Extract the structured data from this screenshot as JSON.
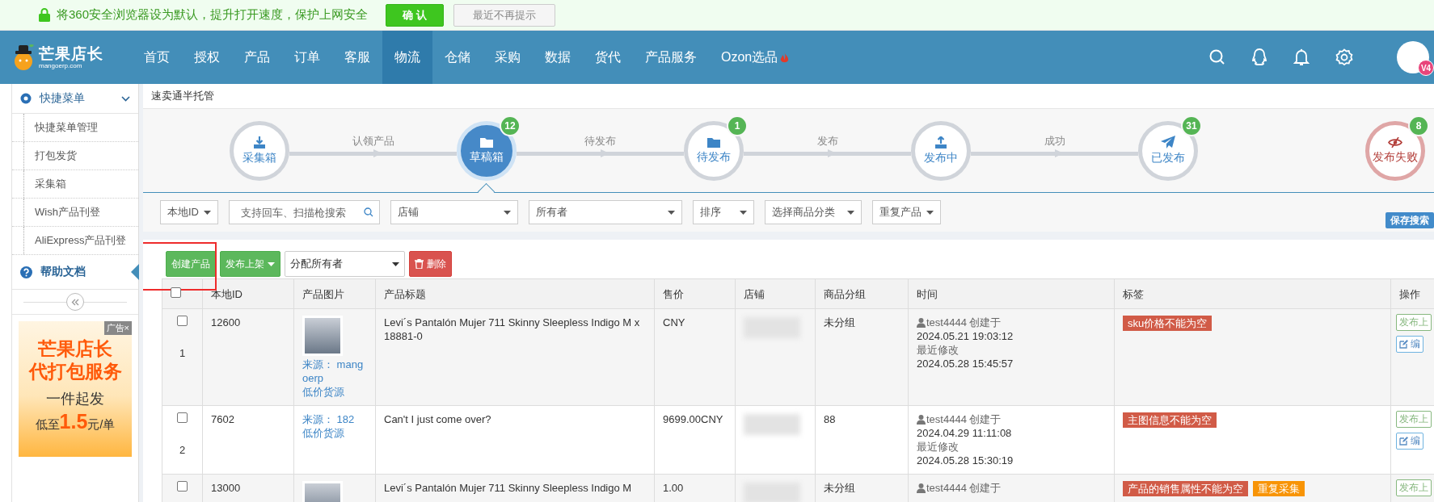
{
  "notice": {
    "text": "将360安全浏览器设为默认，提升打开速度，保护上网安全",
    "confirm": "确 认",
    "dismiss": "最近不再提示"
  },
  "brand": {
    "name": "芒果店长",
    "domain": "mangoerp.com"
  },
  "nav": [
    {
      "label": "首页",
      "selected": false,
      "hot": false
    },
    {
      "label": "授权",
      "selected": false,
      "hot": false
    },
    {
      "label": "产品",
      "selected": false,
      "hot": false
    },
    {
      "label": "订单",
      "selected": false,
      "hot": false
    },
    {
      "label": "客服",
      "selected": false,
      "hot": false
    },
    {
      "label": "物流",
      "selected": true,
      "hot": false
    },
    {
      "label": "仓储",
      "selected": false,
      "hot": false
    },
    {
      "label": "采购",
      "selected": false,
      "hot": false
    },
    {
      "label": "数据",
      "selected": false,
      "hot": false
    },
    {
      "label": "货代",
      "selected": false,
      "hot": false
    },
    {
      "label": "产品服务",
      "selected": false,
      "hot": false
    },
    {
      "label": "Ozon选品",
      "selected": false,
      "hot": true
    }
  ],
  "user": {
    "badge": "V4"
  },
  "sidebar": {
    "menu": {
      "label": "快捷菜单",
      "expanded": true,
      "children": [
        {
          "label": "快捷菜单管理"
        },
        {
          "label": "打包发货"
        },
        {
          "label": "采集箱"
        },
        {
          "label": "Wish产品刊登"
        },
        {
          "label": "AliExpress产品刊登"
        }
      ]
    },
    "help": {
      "label": "帮助文档",
      "selected": true
    },
    "ad": {
      "tag": "广告×",
      "title": "芒果店长",
      "subtitle": "代打包服务",
      "line": "一件起发",
      "price_prefix": "低至",
      "price": "1.5",
      "price_suffix": "元/单"
    }
  },
  "breadcrumb": "速卖通半托管",
  "steps": [
    {
      "label": "采集箱",
      "kind": "normal",
      "selected": false,
      "next_label": "认领产品"
    },
    {
      "label": "草稿箱",
      "kind": "normal",
      "selected": true,
      "count": "12",
      "next_label": "待发布"
    },
    {
      "label": "待发布",
      "kind": "normal",
      "selected": false,
      "count": "1",
      "next_label": "发布"
    },
    {
      "label": "发布中",
      "kind": "normal",
      "selected": false,
      "next_label": "成功"
    },
    {
      "label": "已发布",
      "kind": "normal",
      "selected": false,
      "count": "31"
    },
    {
      "label": "发布失败",
      "kind": "failed",
      "selected": false,
      "count": "8"
    }
  ],
  "filters": [
    {
      "kind": "dropdown",
      "label": "本地ID"
    },
    {
      "kind": "search",
      "placeholder": "支持回车、扫描枪搜索"
    },
    {
      "kind": "select",
      "label": "店铺"
    },
    {
      "kind": "select",
      "label": "所有者"
    },
    {
      "kind": "select",
      "label": "排序"
    },
    {
      "kind": "select",
      "label": "选择商品分类"
    },
    {
      "kind": "dropdown",
      "label": "重复产品"
    }
  ],
  "save_search": "保存搜索",
  "actions": {
    "create": "创建产品",
    "create_highlighted": true,
    "publish": "发布上架",
    "assign_owner": "分配所有者",
    "delete": "删除"
  },
  "table": {
    "columns": [
      "本地ID",
      "产品图片",
      "产品标题",
      "售价",
      "店铺",
      "商品分组",
      "时间",
      "标签",
      "操作"
    ],
    "all_checked": false,
    "rows": [
      {
        "index": "1",
        "checked": false,
        "id": "12600",
        "has_image": true,
        "source": "来源： mangoerp",
        "cheap_source": "低价货源",
        "title": "Levi´s Pantalón Mujer 711 Skinny Sleepless Indigo M x 18881-0",
        "price": "CNY",
        "store_blurred": true,
        "group": "未分组",
        "creator": "test4444 创建于",
        "created": "2024.05.21 19:03:12",
        "modified_label": "最近修改",
        "modified": "2024.05.28 15:45:57",
        "tags": [
          {
            "text": "sku价格不能为空",
            "color": "#d15b47"
          }
        ],
        "ops": [
          "发布上",
          "编"
        ]
      },
      {
        "index": "2",
        "checked": false,
        "id": "7602",
        "has_image": false,
        "source": "来源： 182",
        "cheap_source": "低价货源",
        "title": "Can't I just come over?",
        "price": "9699.00CNY",
        "store_blurred": true,
        "group": "88",
        "creator": "test4444 创建于",
        "created": "2024.04.29 11:11:08",
        "modified_label": "最近修改",
        "modified": "2024.05.28 15:30:19",
        "tags": [
          {
            "text": "主图信息不能为空",
            "color": "#d15b47"
          }
        ],
        "ops": [
          "发布上",
          "编"
        ]
      },
      {
        "checked": false,
        "id": "13000",
        "has_image": true,
        "title": "Levi´s Pantalón Mujer 711 Skinny Sleepless Indigo M",
        "price": "1.00",
        "store_blurred": true,
        "group": "未分组",
        "creator": "test4444 创建于",
        "tags": [
          {
            "text": "产品的销售属性不能为空",
            "color": "#d15b47"
          },
          {
            "text": "重复采集",
            "color": "#f89406"
          }
        ],
        "ops": [
          "发布上"
        ]
      }
    ]
  }
}
